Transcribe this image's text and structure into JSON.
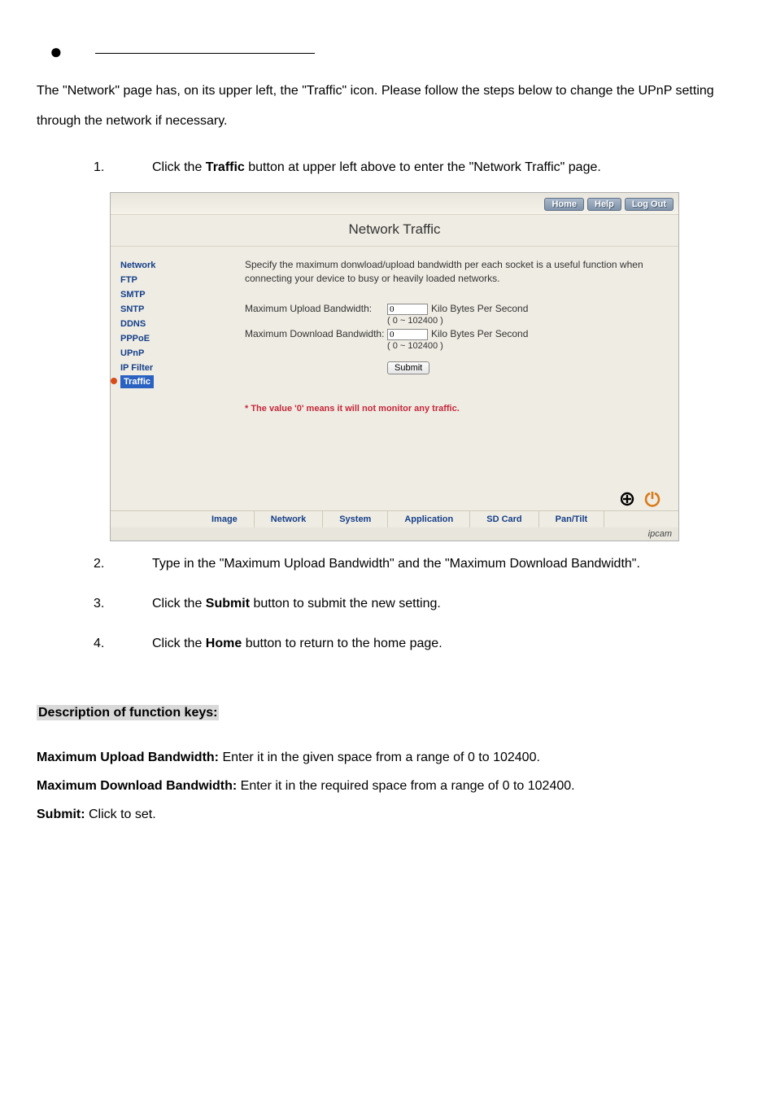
{
  "intro": "The \"Network\" page has, on its upper left, the \"Traffic\" icon. Please follow the steps below to change the UPnP setting through the network if necessary.",
  "steps": [
    {
      "n": "1.",
      "pre": "Click the ",
      "bold": "Traffic",
      "post": " button at upper left above to enter the \"Network Traffic\" page."
    },
    {
      "n": "2.",
      "pre": "Type in the \"Maximum Upload Bandwidth\" and the \"Maximum Download Bandwidth\".",
      "bold": "",
      "post": ""
    },
    {
      "n": "3.",
      "pre": "Click the ",
      "bold": "Submit",
      "post": " button to submit the new setting."
    },
    {
      "n": "4.",
      "pre": "Click the ",
      "bold": "Home",
      "post": " button to return to the home page."
    }
  ],
  "shot": {
    "top": {
      "home": "Home",
      "help": "Help",
      "logout": "Log Out"
    },
    "title": "Network Traffic",
    "side": [
      "Network",
      "FTP",
      "SMTP",
      "SNTP",
      "DDNS",
      "PPPoE",
      "UPnP",
      "IP Filter",
      "Traffic"
    ],
    "side_active_index": 8,
    "spec": "Specify the maximum donwload/upload bandwidth per each socket is a useful function when connecting your device to busy or heavily loaded networks.",
    "rows": {
      "upload_label": "Maximum Upload Bandwidth:",
      "download_label": "Maximum Download Bandwidth:",
      "upload_val": "0",
      "download_val": "0",
      "unit": "Kilo Bytes Per Second",
      "range": "( 0 ~ 102400 )"
    },
    "submit": "Submit",
    "note": "* The value '0' means it will not monitor any traffic.",
    "tabs": [
      "Image",
      "Network",
      "System",
      "Application",
      "SD Card",
      "Pan/Tilt"
    ],
    "footer_id": "ipcam"
  },
  "desc": {
    "heading": "Description of function keys:",
    "items": [
      {
        "bold": "Maximum Upload Bandwidth:",
        "text": " Enter it in the given space from a range of 0 to 102400."
      },
      {
        "bold": "Maximum Download Bandwidth:",
        "text": " Enter it in the required space from a range of 0 to 102400."
      },
      {
        "bold": "Submit:",
        "text": " Click to set."
      }
    ]
  }
}
